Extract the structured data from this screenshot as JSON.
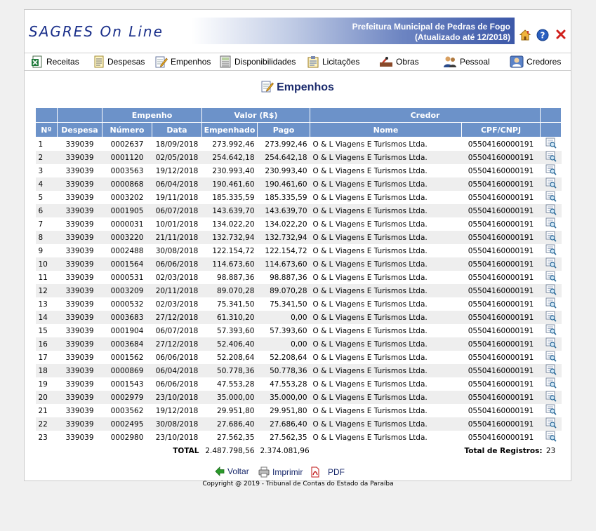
{
  "header": {
    "logo": "SAGRES On Line",
    "title": "Prefeitura Municipal de Pedras de Fogo",
    "updated": "(Atualizado até 12/2018)"
  },
  "menu": [
    {
      "label": "Receitas"
    },
    {
      "label": "Despesas"
    },
    {
      "label": "Empenhos"
    },
    {
      "label": "Disponibilidades"
    },
    {
      "label": "Licitações"
    },
    {
      "label": "Obras"
    },
    {
      "label": "Pessoal"
    },
    {
      "label": "Credores"
    }
  ],
  "page": {
    "title": "Empenhos"
  },
  "table": {
    "group_headers": {
      "empenho": "Empenho",
      "valor": "Valor (R$)",
      "credor": "Credor"
    },
    "headers": [
      "Nº",
      "Despesa",
      "Número",
      "Data",
      "Empenhado",
      "Pago",
      "Nome",
      "CPF/CNPJ"
    ],
    "rows": [
      [
        "1",
        "339039",
        "0002637",
        "18/09/2018",
        "273.992,46",
        "273.992,46",
        "O & L Viagens E Turismos Ltda.",
        "05504160000191"
      ],
      [
        "2",
        "339039",
        "0001120",
        "02/05/2018",
        "254.642,18",
        "254.642,18",
        "O & L Viagens E Turismos Ltda.",
        "05504160000191"
      ],
      [
        "3",
        "339039",
        "0003563",
        "19/12/2018",
        "230.993,40",
        "230.993,40",
        "O & L Viagens E Turismos Ltda.",
        "05504160000191"
      ],
      [
        "4",
        "339039",
        "0000868",
        "06/04/2018",
        "190.461,60",
        "190.461,60",
        "O & L Viagens E Turismos Ltda.",
        "05504160000191"
      ],
      [
        "5",
        "339039",
        "0003202",
        "19/11/2018",
        "185.335,59",
        "185.335,59",
        "O & L Viagens E Turismos Ltda.",
        "05504160000191"
      ],
      [
        "6",
        "339039",
        "0001905",
        "06/07/2018",
        "143.639,70",
        "143.639,70",
        "O & L Viagens E Turismos Ltda.",
        "05504160000191"
      ],
      [
        "7",
        "339039",
        "0000031",
        "10/01/2018",
        "134.022,20",
        "134.022,20",
        "O & L Viagens E Turismos Ltda.",
        "05504160000191"
      ],
      [
        "8",
        "339039",
        "0003220",
        "21/11/2018",
        "132.732,94",
        "132.732,94",
        "O & L Viagens E Turismos Ltda.",
        "05504160000191"
      ],
      [
        "9",
        "339039",
        "0002488",
        "30/08/2018",
        "122.154,72",
        "122.154,72",
        "O & L Viagens E Turismos Ltda.",
        "05504160000191"
      ],
      [
        "10",
        "339039",
        "0001564",
        "06/06/2018",
        "114.673,60",
        "114.673,60",
        "O & L Viagens E Turismos Ltda.",
        "05504160000191"
      ],
      [
        "11",
        "339039",
        "0000531",
        "02/03/2018",
        "98.887,36",
        "98.887,36",
        "O & L Viagens E Turismos Ltda.",
        "05504160000191"
      ],
      [
        "12",
        "339039",
        "0003209",
        "20/11/2018",
        "89.070,28",
        "89.070,28",
        "O & L Viagens E Turismos Ltda.",
        "05504160000191"
      ],
      [
        "13",
        "339039",
        "0000532",
        "02/03/2018",
        "75.341,50",
        "75.341,50",
        "O & L Viagens E Turismos Ltda.",
        "05504160000191"
      ],
      [
        "14",
        "339039",
        "0003683",
        "27/12/2018",
        "61.310,20",
        "0,00",
        "O & L Viagens E Turismos Ltda.",
        "05504160000191"
      ],
      [
        "15",
        "339039",
        "0001904",
        "06/07/2018",
        "57.393,60",
        "57.393,60",
        "O & L Viagens E Turismos Ltda.",
        "05504160000191"
      ],
      [
        "16",
        "339039",
        "0003684",
        "27/12/2018",
        "52.406,40",
        "0,00",
        "O & L Viagens E Turismos Ltda.",
        "05504160000191"
      ],
      [
        "17",
        "339039",
        "0001562",
        "06/06/2018",
        "52.208,64",
        "52.208,64",
        "O & L Viagens E Turismos Ltda.",
        "05504160000191"
      ],
      [
        "18",
        "339039",
        "0000869",
        "06/04/2018",
        "50.778,36",
        "50.778,36",
        "O & L Viagens E Turismos Ltda.",
        "05504160000191"
      ],
      [
        "19",
        "339039",
        "0001543",
        "06/06/2018",
        "47.553,28",
        "47.553,28",
        "O & L Viagens E Turismos Ltda.",
        "05504160000191"
      ],
      [
        "20",
        "339039",
        "0002979",
        "23/10/2018",
        "35.000,00",
        "35.000,00",
        "O & L Viagens E Turismos Ltda.",
        "05504160000191"
      ],
      [
        "21",
        "339039",
        "0003562",
        "19/12/2018",
        "29.951,80",
        "29.951,80",
        "O & L Viagens E Turismos Ltda.",
        "05504160000191"
      ],
      [
        "22",
        "339039",
        "0002495",
        "30/08/2018",
        "27.686,40",
        "27.686,40",
        "O & L Viagens E Turismos Ltda.",
        "05504160000191"
      ],
      [
        "23",
        "339039",
        "0002980",
        "23/10/2018",
        "27.562,35",
        "27.562,35",
        "O & L Viagens E Turismos Ltda.",
        "05504160000191"
      ]
    ],
    "total_label": "TOTAL",
    "total_empenhado": "2.487.798,56",
    "total_pago": "2.374.081,96",
    "records_label": "Total de Registros:",
    "records_count": "23"
  },
  "actions": {
    "back": "Voltar",
    "print": "Imprimir",
    "pdf": "PDF"
  },
  "footer": {
    "copyright": "Copyright @ 2019 - Tribunal de Contas do Estado da Paraíba"
  },
  "icons": {
    "home": "home-icon",
    "help": "help-icon",
    "close": "close-icon",
    "detail": "detail-magnifier-icon"
  },
  "colors": {
    "table_header": "#6c92c9",
    "title": "#1a2a6c",
    "banner_dark": "#3c58a8"
  }
}
